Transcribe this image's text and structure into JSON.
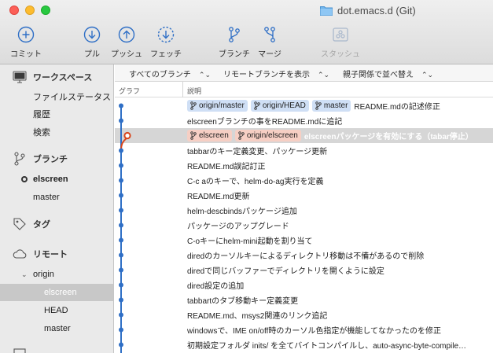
{
  "window": {
    "title": "dot.emacs.d (Git)"
  },
  "toolbar": {
    "commit": "コミット",
    "pull": "プル",
    "push": "プッシュ",
    "fetch": "フェッチ",
    "branch": "ブランチ",
    "merge": "マージ",
    "stash": "スタッシュ"
  },
  "sidebar": {
    "workspace": {
      "title": "ワークスペース",
      "items": [
        "ファイルステータス",
        "履歴",
        "検索"
      ]
    },
    "branches": {
      "title": "ブランチ",
      "items": [
        "elscreen",
        "master"
      ]
    },
    "tags": {
      "title": "タグ"
    },
    "remotes": {
      "title": "リモート",
      "origin": "origin",
      "items": [
        "elscreen",
        "HEAD",
        "master"
      ]
    },
    "more": {
      "title": "…"
    }
  },
  "filters": {
    "all_branches": "すべてのブランチ",
    "show_remote": "リモートブランチを表示",
    "order": "親子関係で並べ替え"
  },
  "columns": {
    "graph": "グラフ",
    "description": "説明"
  },
  "commits": [
    {
      "tags": [
        {
          "label": "origin/master",
          "color": "blue"
        },
        {
          "label": "origin/HEAD",
          "color": "blue"
        },
        {
          "label": "master",
          "color": "blue"
        }
      ],
      "message": "README.mdの記述修正"
    },
    {
      "tags": [],
      "message": "elscreenブランチの事をREADME.mdに追記"
    },
    {
      "tags": [
        {
          "label": "elscreen",
          "color": "red"
        },
        {
          "label": "origin/elscreen",
          "color": "red"
        }
      ],
      "message": "elscreenパッケージを有効にする（tabar停止）"
    },
    {
      "tags": [],
      "message": "tabbarのキー定義変更、パッケージ更新"
    },
    {
      "tags": [],
      "message": "README.md誤記訂正"
    },
    {
      "tags": [],
      "message": "C-c aのキーで、helm-do-ag実行を定義"
    },
    {
      "tags": [],
      "message": "README.md更新"
    },
    {
      "tags": [],
      "message": "helm-descbindsパッケージ追加"
    },
    {
      "tags": [],
      "message": "パッケージのアップグレード"
    },
    {
      "tags": [],
      "message": "C-oキーにhelm-mini起動を割り当て"
    },
    {
      "tags": [],
      "message": "diredのカーソルキーによるディレクトリ移動は不備があるので削除"
    },
    {
      "tags": [],
      "message": "diredで同じバッファーでディレクトリを開くように設定"
    },
    {
      "tags": [],
      "message": "dired設定の追加"
    },
    {
      "tags": [],
      "message": "tabbartのタブ移動キー定義変更"
    },
    {
      "tags": [],
      "message": "README.md、msys2関連のリンク追記"
    },
    {
      "tags": [],
      "message": "windowsで、IME on/off時のカーソル色指定が機能してなかったのを修正"
    },
    {
      "tags": [],
      "message": "初期設定フォルダ inits/ を全てバイトコンパイルし、auto-async-byte-compile…"
    }
  ],
  "colors": {
    "master_line": "#2f6fc6",
    "elscreen_line": "#d8451b",
    "tag_blue": "#cfdff5",
    "tag_red": "#f6cfc4",
    "selected_row": "#d6d6d6"
  },
  "selected_commit_index": 2
}
